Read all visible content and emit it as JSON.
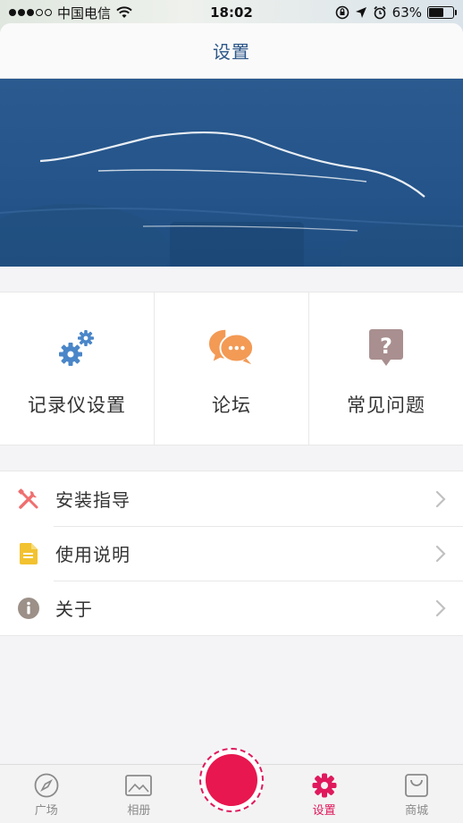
{
  "status_bar": {
    "carrier": "中国电信",
    "time": "18:02",
    "battery_percent": "63%",
    "battery_level": 0.63
  },
  "nav": {
    "title": "设置"
  },
  "grid": [
    {
      "label": "记录仪设置",
      "icon": "gears-icon",
      "color": "#4a86c8"
    },
    {
      "label": "论坛",
      "icon": "chat-bubbles-icon",
      "color": "#f39a55"
    },
    {
      "label": "常见问题",
      "icon": "question-icon",
      "color": "#a98f8f"
    }
  ],
  "list": [
    {
      "label": "安装指导",
      "icon": "tools-icon",
      "color": "#ef6f6f"
    },
    {
      "label": "使用说明",
      "icon": "document-icon",
      "color": "#f2c230"
    },
    {
      "label": "关于",
      "icon": "info-icon",
      "color": "#9c9088"
    }
  ],
  "tabs": [
    {
      "label": "广场",
      "icon": "compass-icon"
    },
    {
      "label": "相册",
      "icon": "photo-icon"
    },
    {
      "label": "",
      "icon": "record-icon"
    },
    {
      "label": "设置",
      "icon": "settings-gear-icon",
      "active": true
    },
    {
      "label": "商城",
      "icon": "shopping-bag-icon"
    }
  ],
  "accent_color": "#e0195d"
}
